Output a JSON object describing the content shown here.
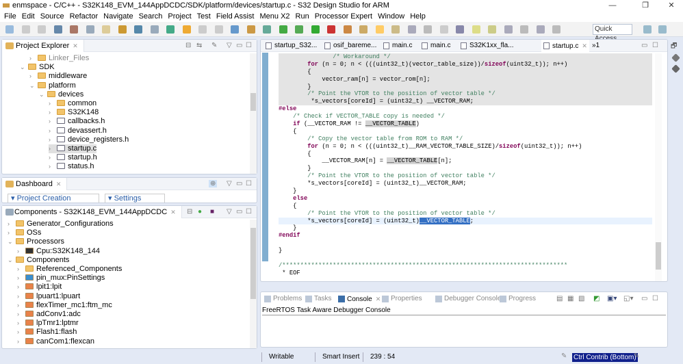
{
  "window": {
    "title": "enmspace - C/C++ - S32K148_EVM_144AppDCDC/SDK/platform/devices/startup.c - S32 Design Studio for ARM",
    "minimize": "—",
    "restore": "❐",
    "close": "✕"
  },
  "menu": [
    "File",
    "Edit",
    "Source",
    "Refactor",
    "Navigate",
    "Search",
    "Project",
    "Test",
    "Field Assist",
    "Menu X2",
    "Run",
    "Processor Expert",
    "Window",
    "Help"
  ],
  "toolbar": {
    "quick_access_placeholder": "Quick Access"
  },
  "project_explorer": {
    "title": "Project Explorer",
    "items": [
      {
        "label": "Linker_Files",
        "depth": 1,
        "expand": ">",
        "icon": "folder",
        "dim": true
      },
      {
        "label": "SDK",
        "depth": 0,
        "expand": "v",
        "icon": "folder"
      },
      {
        "label": "middleware",
        "depth": 1,
        "expand": ">",
        "icon": "folder"
      },
      {
        "label": "platform",
        "depth": 1,
        "expand": "v",
        "icon": "folder"
      },
      {
        "label": "devices",
        "depth": 2,
        "expand": "v",
        "icon": "folder"
      },
      {
        "label": "common",
        "depth": 3,
        "expand": ">",
        "icon": "folder"
      },
      {
        "label": "S32K148",
        "depth": 3,
        "expand": ">",
        "icon": "folder"
      },
      {
        "label": "callbacks.h",
        "depth": 3,
        "expand": ">",
        "icon": "h-file"
      },
      {
        "label": "devassert.h",
        "depth": 3,
        "expand": ">",
        "icon": "h-file"
      },
      {
        "label": "device_registers.h",
        "depth": 3,
        "expand": ">",
        "icon": "h-file"
      },
      {
        "label": "startup.c",
        "depth": 3,
        "expand": ">",
        "icon": "c-file",
        "selected": true
      },
      {
        "label": "startup.h",
        "depth": 3,
        "expand": ">",
        "icon": "h-file"
      },
      {
        "label": "status.h",
        "depth": 3,
        "expand": ">",
        "icon": "h-file"
      }
    ]
  },
  "dashboard": {
    "title": "Dashboard",
    "sections": [
      "Project Creation",
      "Settings"
    ]
  },
  "components": {
    "title": "Components - S32K148_EVM_144AppDCDC",
    "items": [
      {
        "label": "Generator_Configurations",
        "depth": 0,
        "expand": ">",
        "icon": "folder"
      },
      {
        "label": "OSs",
        "depth": 0,
        "expand": ">",
        "icon": "folder"
      },
      {
        "label": "Processors",
        "depth": 0,
        "expand": "v",
        "icon": "folder"
      },
      {
        "label": "Cpu:S32K148_144",
        "depth": 1,
        "expand": ">",
        "icon": "cpu"
      },
      {
        "label": "Components",
        "depth": 0,
        "expand": "v",
        "icon": "folder"
      },
      {
        "label": "Referenced_Components",
        "depth": 1,
        "expand": ">",
        "icon": "folder"
      },
      {
        "label": "pin_mux:PinSettings",
        "depth": 1,
        "expand": ">",
        "icon": "pins"
      },
      {
        "label": "lpit1:lpit",
        "depth": 1,
        "expand": ">",
        "icon": "component"
      },
      {
        "label": "lpuart1:lpuart",
        "depth": 1,
        "expand": ">",
        "icon": "component"
      },
      {
        "label": "flexTimer_mc1:ftm_mc",
        "depth": 1,
        "expand": ">",
        "icon": "component"
      },
      {
        "label": "adConv1:adc",
        "depth": 1,
        "expand": ">",
        "icon": "component"
      },
      {
        "label": "lpTmr1:lptmr",
        "depth": 1,
        "expand": ">",
        "icon": "component"
      },
      {
        "label": "Flash1:flash",
        "depth": 1,
        "expand": ">",
        "icon": "component"
      },
      {
        "label": "canCom1:flexcan",
        "depth": 1,
        "expand": ">",
        "icon": "component"
      }
    ]
  },
  "editor": {
    "tabs": [
      {
        "label": "startup_S32...",
        "icon": "s-file"
      },
      {
        "label": "osif_bareme...",
        "icon": "c-file"
      },
      {
        "label": "main.c",
        "icon": "c-file"
      },
      {
        "label": "main.c",
        "icon": "c-file"
      },
      {
        "label": "S32K1xx_fla...",
        "icon": "x-file"
      },
      {
        "label": "startup.c",
        "icon": "c-file",
        "active": true
      }
    ],
    "overflow": "»1",
    "lines": [
      "               /* Workaround */",
      "        for (n = 0; n < (((uint32_t)(vector_table_size))/sizeof(uint32_t)); n++)",
      "        {",
      "            vector_ram[n] = vector_rom[n];",
      "        }",
      "        /* Point the VTOR to the position of vector table */",
      "         *s_vectors[coreId] = (uint32_t) __VECTOR_RAM;",
      "#else",
      "    /* Check if VECTOR_TABLE copy is needed */",
      "    if (__VECTOR_RAM != __VECTOR_TABLE)",
      "    {",
      "        /* Copy the vector table from ROM to RAM */",
      "        for (n = 0; n < (((uint32_t)__RAM_VECTOR_TABLE_SIZE)/sizeof(uint32_t)); n++)",
      "        {",
      "            __VECTOR_RAM[n] = __VECTOR_TABLE[n];",
      "        }",
      "        /* Point the VTOR to the position of vector table */",
      "        *s_vectors[coreId] = (uint32_t)__VECTOR_RAM;",
      "    }",
      "    else",
      "    {",
      "        /* Point the VTOR to the position of vector table */",
      "        *s_vectors[coreId] = (uint32_t)__VECTOR_TABLE;",
      "    }",
      "#endif",
      "",
      "}",
      "",
      "/*******************************************************************************",
      " * EOF"
    ],
    "selected_text": "__VECTOR_TABLE"
  },
  "bottom_panel": {
    "tabs": [
      {
        "label": "Problems"
      },
      {
        "label": "Tasks"
      },
      {
        "label": "Console",
        "active": true
      },
      {
        "label": "Properties"
      },
      {
        "label": "Debugger Console"
      },
      {
        "label": "Progress"
      }
    ],
    "console_title": "FreeRTOS Task Aware Debugger Console"
  },
  "status": {
    "mode": "Writable",
    "insert": "Smart Insert",
    "position": "239 : 54",
    "contrib": "Ctrl Contrib (Bottom)"
  },
  "colors": {
    "keyword": "#7f0055",
    "comment": "#3f7f5f",
    "selection": "#3470c4",
    "current_line": "#e8f2fe",
    "inactive_code": "#e4e4e4"
  }
}
